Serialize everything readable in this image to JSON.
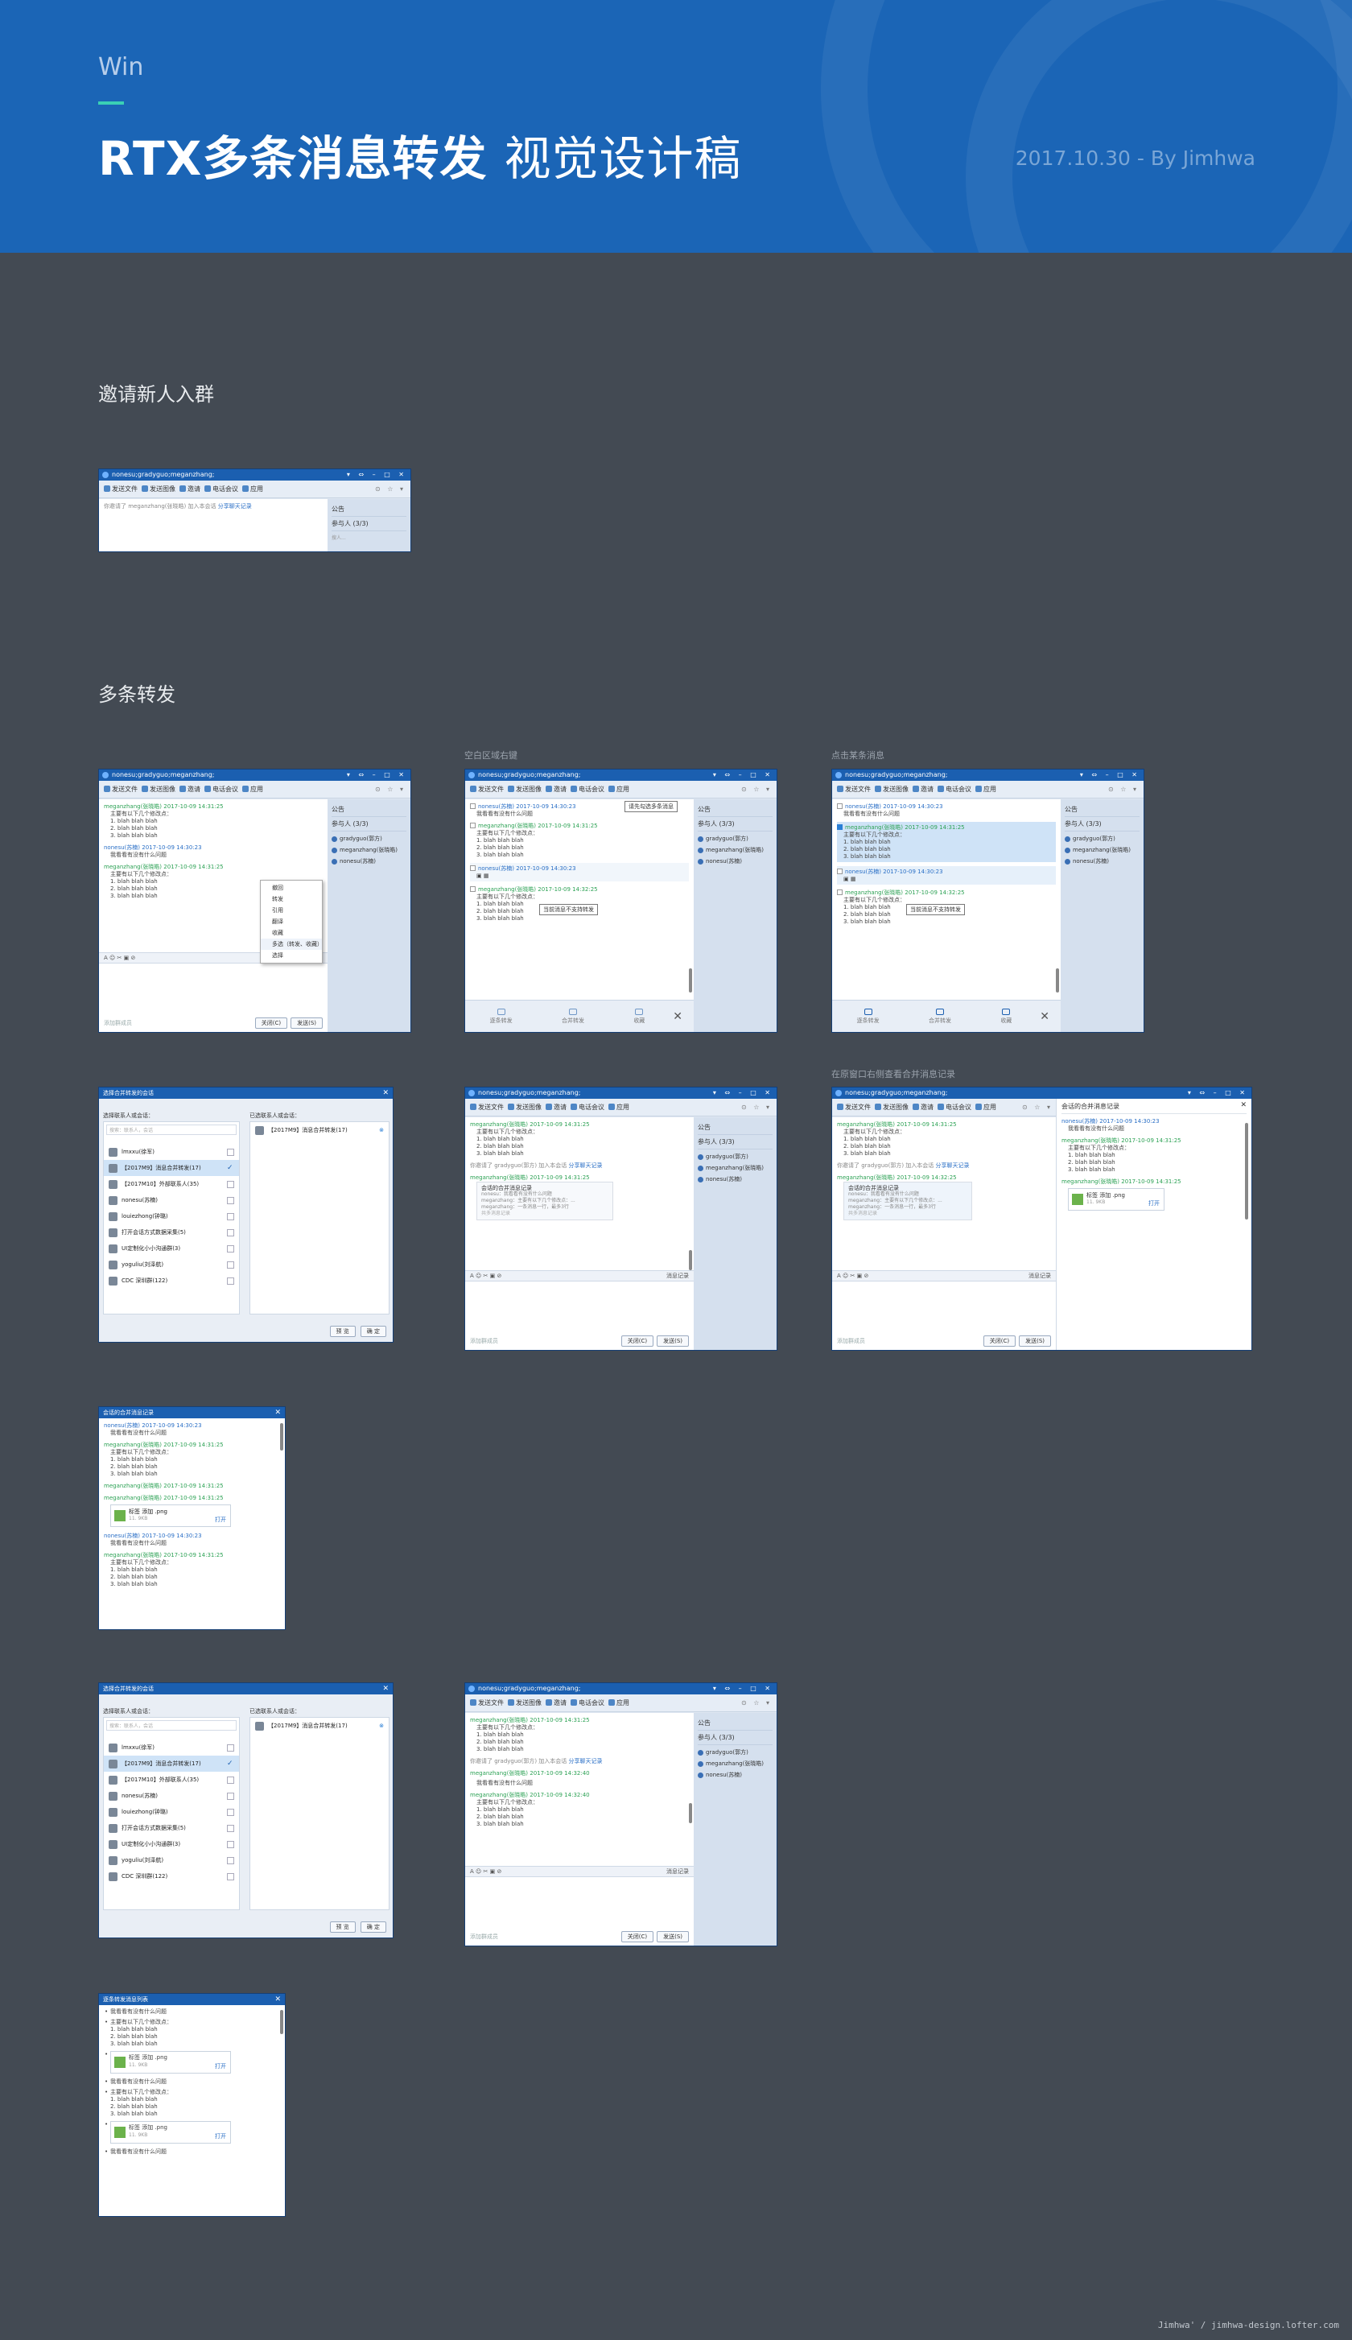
{
  "header": {
    "platform": "Win",
    "title_bold": "RTX多条消息转发",
    "title_light": "视觉设计稿",
    "date_author": "2017.10.30 - By Jimhwa"
  },
  "sections": {
    "invite": "邀请新人入群",
    "forward": "多条转发"
  },
  "captions": {
    "blank_right_click": "空白区域右键",
    "click_some": "点击某条消息",
    "right_view": "在原窗口右侧查看合并消息记录"
  },
  "window": {
    "title": "nonesu;gradyguo;meganzhang;",
    "toolbar": [
      "发送文件",
      "发送图像",
      "邀请",
      "电话会议",
      "应用"
    ],
    "controls": "▾ ⇔ – □ ✕",
    "toolbar_right": "⊙ ☆ ▾",
    "announcement": "公告",
    "participants": "参与人",
    "participants_count": "(3/3)",
    "search_hint": "搜人...",
    "members": [
      "gradyguo(郭方)",
      "meganzhang(张晓皓)",
      "nonesu(苏楠)"
    ],
    "chat_history": "消息记录",
    "close": "关闭(C)",
    "send": "发送(S)",
    "hint": "添加群成员"
  },
  "invite_msg": "你邀请了 meganzhang(张晓皓) 加入本会话",
  "invite_link": "分享聊天记录",
  "messages": {
    "m1_name": "meganzhang(张晓皓)",
    "m1_time": "2017-10-09 14:31:25",
    "m1_lines": [
      "主要有以下几个修改点：",
      "1. blah blah blah",
      "2. blah blah blah",
      "3. blah blah blah"
    ],
    "m2_name": "nonesu(苏楠)",
    "m2_time": "2017-10-09 14:30:23",
    "m2_line": "我看看有没有什么问题",
    "m3_time": "2017-10-09 14:31:25",
    "m4_time": "2017-10-09 14:32:40",
    "m5_time": "2017-10-09 14:32:25",
    "sys_invite": "你邀请了 gradyguo(郭方) 加入本会话",
    "sys_link": "分享聊天记录"
  },
  "context_menu": [
    "撤回",
    "转发",
    "引用",
    "翻译",
    "收藏",
    "多选（转发、收藏）",
    "选择"
  ],
  "multi_actions": [
    "逐条转发",
    "合并转发",
    "收藏"
  ],
  "tips": {
    "select_messages": "请先勾选多条消息",
    "not_supported": "当前消息不支持转发"
  },
  "select_dialog": {
    "title": "选择合并转发的会话",
    "left_label": "选择联系人或会话：",
    "right_label": "已选联系人或会话：",
    "search": "搜索：联系人，会话",
    "contacts": [
      "lmxxu(徐军)",
      "【2017M9】消息合并转发(17)",
      "【2017M10】外部联系人(35)",
      "nonesu(苏楠)",
      "louiezhong(钟璐)",
      "打开会话方式数据采集(5)",
      "UI定制化小小沟通群(3)",
      "yoguliu(刘泽航)",
      "CDC 深圳群(122)"
    ],
    "selected": "【2017M9】消息合并转发(17)",
    "preview": "预 览",
    "ok": "确 定"
  },
  "merged": {
    "title": "会话的合并消息记录",
    "file_name": "标签 添加 .png",
    "file_size": "11. 9KB",
    "open": "打开",
    "quote_lines": [
      "nonesu：我看看有没有什么问题",
      "meganzhang：主要有以下几个修改点：...",
      "meganzhang：一条消息一行，最多3行"
    ],
    "quote_more": "共多消息记录"
  },
  "multi_list": {
    "title": "逐条转发消息列表"
  },
  "footer": "Jimhwa' / jimhwa-design.lofter.com"
}
